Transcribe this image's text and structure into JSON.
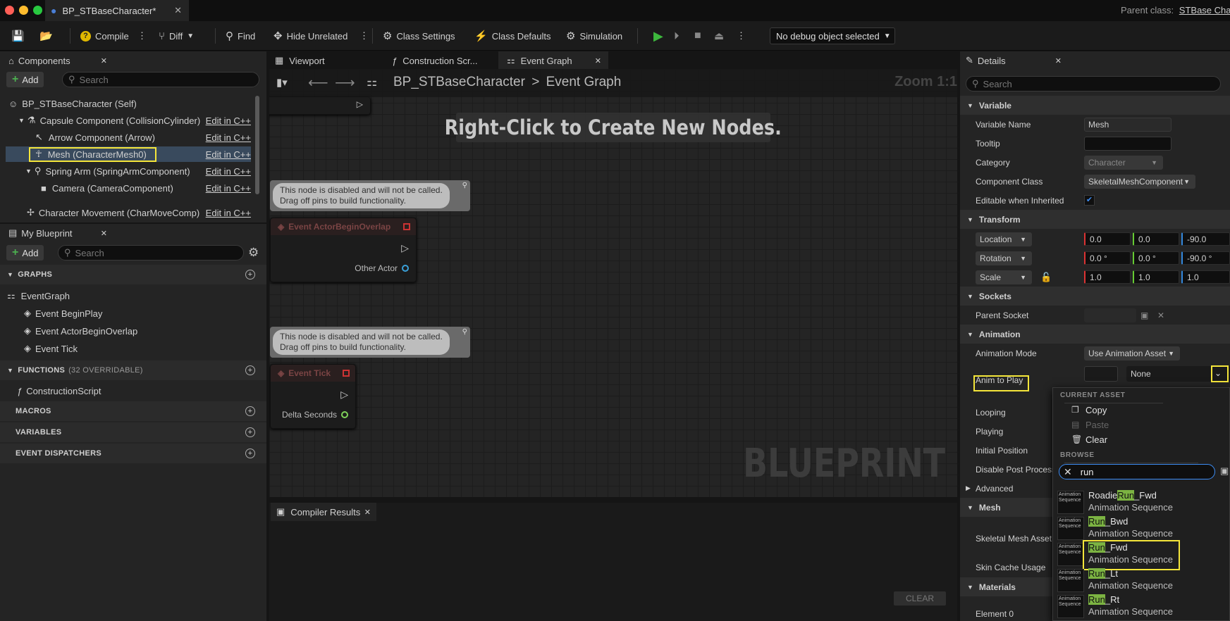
{
  "titlebar": {
    "tab_title": "BP_STBaseCharacter*",
    "parent_class_label": "Parent class:",
    "parent_class_value": "STBase Chara"
  },
  "toolbar": {
    "compile": "Compile",
    "diff": "Diff",
    "find": "Find",
    "hide_unrelated": "Hide Unrelated",
    "class_settings": "Class Settings",
    "class_defaults": "Class Defaults",
    "simulation": "Simulation",
    "debug_object": "No debug object selected"
  },
  "components": {
    "tab_label": "Components",
    "add_label": "Add",
    "search_placeholder": "Search",
    "items": [
      {
        "label": "BP_STBaseCharacter (Self)",
        "edit": ""
      },
      {
        "label": "Capsule Component (CollisionCylinder)",
        "edit": "Edit in C++"
      },
      {
        "label": "Arrow Component (Arrow)",
        "edit": "Edit in C++"
      },
      {
        "label": "Mesh (CharacterMesh0)",
        "edit": "Edit in C++"
      },
      {
        "label": "Spring Arm (SpringArmComponent)",
        "edit": "Edit in C++"
      },
      {
        "label": "Camera (CameraComponent)",
        "edit": "Edit in C++"
      },
      {
        "label": "Character Movement (CharMoveComp)",
        "edit": "Edit in C++"
      }
    ]
  },
  "my_blueprint": {
    "tab_label": "My Blueprint",
    "add_label": "Add",
    "search_placeholder": "Search",
    "graphs_header": "GRAPHS",
    "graph_items": [
      "EventGraph",
      "Event BeginPlay",
      "Event ActorBeginOverlap",
      "Event Tick"
    ],
    "functions_header": "FUNCTIONS",
    "functions_count": "(32 OVERRIDABLE)",
    "function_items": [
      "ConstructionScript"
    ],
    "macros_header": "MACROS",
    "variables_header": "VARIABLES",
    "dispatchers_header": "EVENT DISPATCHERS"
  },
  "editor_tabs": [
    "Viewport",
    "Construction Scr...",
    "Event Graph"
  ],
  "graph": {
    "breadcrumb_root": "BP_STBaseCharacter",
    "breadcrumb_sep": ">",
    "breadcrumb_leaf": "Event Graph",
    "zoom": "Zoom 1:1",
    "hint": "Right-Click to Create New Nodes.",
    "watermark": "BLUEPRINT",
    "disabled_msg_1": "This node is disabled and will not be called.",
    "disabled_msg_2": "Drag off pins to build functionality.",
    "node1_title": "Event ActorBeginOverlap",
    "node1_pin": "Other Actor",
    "node2_title": "Event Tick",
    "node2_pin": "Delta Seconds"
  },
  "compiler": {
    "tab_label": "Compiler Results",
    "clear_label": "CLEAR"
  },
  "details": {
    "tab_label": "Details",
    "search_placeholder": "Search",
    "cat_variable": "Variable",
    "variable_name_label": "Variable Name",
    "variable_name_value": "Mesh",
    "tooltip_label": "Tooltip",
    "category_label": "Category",
    "category_value": "Character",
    "component_class_label": "Component Class",
    "component_class_value": "SkeletalMeshComponent",
    "editable_label": "Editable when Inherited",
    "cat_transform": "Transform",
    "location_label": "Location",
    "location_values": [
      "0.0",
      "0.0",
      "-90.0"
    ],
    "rotation_label": "Rotation",
    "rotation_values": [
      "0.0 °",
      "0.0 °",
      "-90.0 °"
    ],
    "scale_label": "Scale",
    "scale_values": [
      "1.0",
      "1.0",
      "1.0"
    ],
    "cat_sockets": "Sockets",
    "parent_socket_label": "Parent Socket",
    "cat_animation": "Animation",
    "animation_mode_label": "Animation Mode",
    "animation_mode_value": "Use Animation Asset",
    "anim_to_play_label": "Anim to Play",
    "anim_to_play_value": "None",
    "looping_label": "Looping",
    "playing_label": "Playing",
    "initial_position_label": "Initial Position",
    "disable_post_label": "Disable Post Process",
    "advanced_label": "Advanced",
    "cat_mesh": "Mesh",
    "skeletal_mesh_label": "Skeletal Mesh Asset",
    "skin_cache_label": "Skin Cache Usage",
    "cat_materials": "Materials",
    "element0_label": "Element 0"
  },
  "popup": {
    "current_asset_header": "CURRENT ASSET",
    "copy": "Copy",
    "paste": "Paste",
    "clear": "Clear",
    "browse_header": "BROWSE",
    "search_value": "run",
    "thumb_label": "Animation Sequence",
    "assets": [
      {
        "pre": "Roadie",
        "match": "Run",
        "post": "_Fwd",
        "type": "Animation Sequence"
      },
      {
        "pre": "",
        "match": "Run",
        "post": "_Bwd",
        "type": "Animation Sequence"
      },
      {
        "pre": "",
        "match": "Run",
        "post": "_Fwd",
        "type": "Animation Sequence"
      },
      {
        "pre": "",
        "match": "Run",
        "post": "_Lt",
        "type": "Animation Sequence"
      },
      {
        "pre": "",
        "match": "Run",
        "post": "_Rt",
        "type": "Animation Sequence"
      }
    ]
  }
}
